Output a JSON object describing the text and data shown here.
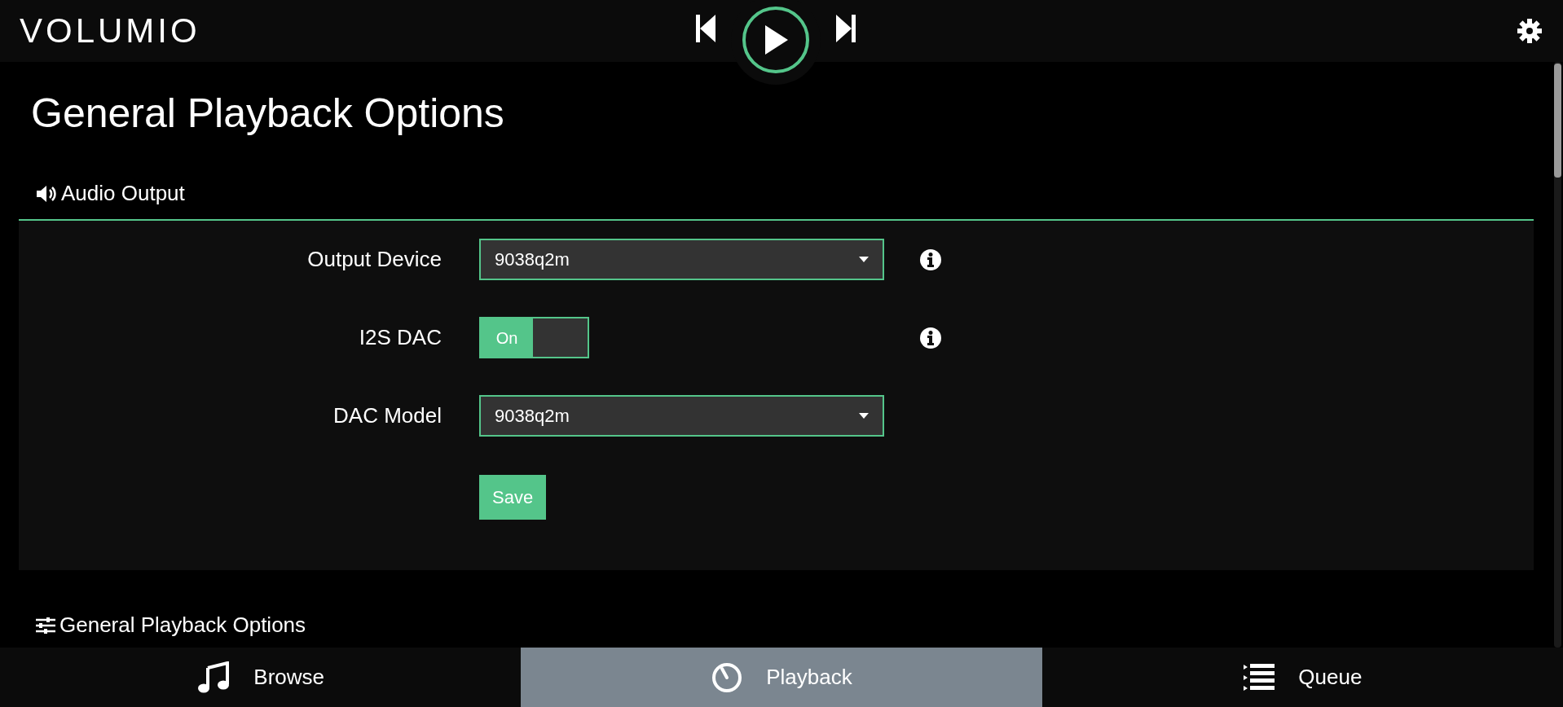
{
  "header": {
    "logo": "VOLUMIO",
    "playing": false
  },
  "page_title": "General Playback Options",
  "sections": [
    {
      "title": "Audio Output",
      "rows": [
        {
          "kind": "select",
          "label": "Output Device",
          "value": "9038q2m",
          "info": true
        },
        {
          "kind": "toggle",
          "label": "I2S DAC",
          "on": true,
          "on_label": "On",
          "info": true
        },
        {
          "kind": "select",
          "label": "DAC Model",
          "value": "9038q2m",
          "info": false
        }
      ],
      "button": "Save"
    },
    {
      "title": "General Playback Options"
    }
  ],
  "tabs": [
    {
      "label": "Browse",
      "selected": false
    },
    {
      "label": "Playback",
      "selected": true
    },
    {
      "label": "Queue",
      "selected": false
    }
  ]
}
